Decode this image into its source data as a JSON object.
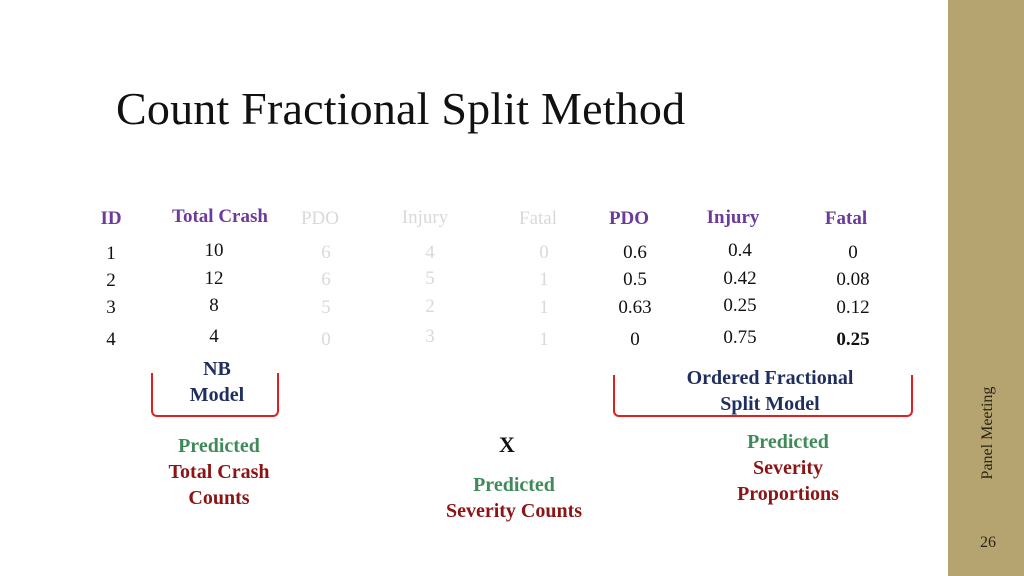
{
  "slide": {
    "title": "Count Fractional Split Method",
    "sidebar_label": "Panel Meeting",
    "page_number": "26"
  },
  "colors": {
    "header_purple": "#6b3a9a",
    "model_navy": "#1f2e5f",
    "predicted_green": "#3f8a5a",
    "result_maroon": "#8b1414",
    "bracket_red": "#e02020",
    "sidebar_gold": "#b5a46f",
    "faded_gray": "#d9d9d9"
  },
  "table": {
    "headers": {
      "id": "ID",
      "total_crash": "Total Crash",
      "pdo_count": "PDO",
      "injury_count": "Injury",
      "fatal_count": "Fatal",
      "pdo_prop": "PDO",
      "injury_prop": "Injury",
      "fatal_prop": "Fatal"
    },
    "rows": [
      {
        "id": "1",
        "total_crash": "10",
        "pdo_count": "6",
        "injury_count": "4",
        "fatal_count": "0",
        "pdo_prop": "0.6",
        "injury_prop": "0.4",
        "fatal_prop": "0"
      },
      {
        "id": "2",
        "total_crash": "12",
        "pdo_count": "6",
        "injury_count": "5",
        "fatal_count": "1",
        "pdo_prop": "0.5",
        "injury_prop": "0.42",
        "fatal_prop": "0.08"
      },
      {
        "id": "3",
        "total_crash": "8",
        "pdo_count": "5",
        "injury_count": "2",
        "fatal_count": "1",
        "pdo_prop": "0.63",
        "injury_prop": "0.25",
        "fatal_prop": "0.12"
      },
      {
        "id": "4",
        "total_crash": "4",
        "pdo_count": "0",
        "injury_count": "3",
        "fatal_count": "1",
        "pdo_prop": "0",
        "injury_prop": "0.75",
        "fatal_prop": "0.25"
      }
    ]
  },
  "models": {
    "nb": {
      "line1": "NB",
      "line2": "Model"
    },
    "ofs": {
      "line1": "Ordered Fractional",
      "line2": "Split Model"
    }
  },
  "annotations": {
    "total_counts": {
      "line1": "Predicted",
      "line2": "Total Crash",
      "line3": "Counts"
    },
    "multiply": "X",
    "severity_counts": {
      "line1": "Predicted",
      "line2": "Severity Counts"
    },
    "severity_props": {
      "line1": "Predicted",
      "line2": "Severity",
      "line3": "Proportions"
    }
  }
}
